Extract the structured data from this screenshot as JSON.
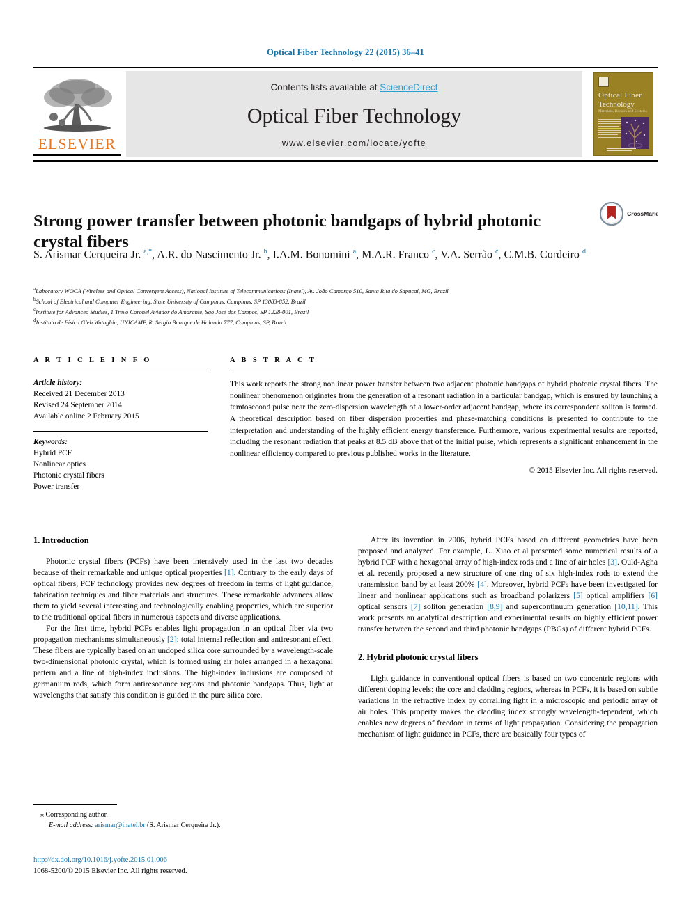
{
  "running_head": "Optical Fiber Technology 22 (2015) 36–41",
  "masthead": {
    "contents_prefix": "Contents lists available at ",
    "sciencedirect": "ScienceDirect",
    "journal_title": "Optical Fiber Technology",
    "journal_url": "www.elsevier.com/locate/yofte",
    "publisher_logo_text": "ELSEVIER",
    "cover": {
      "line1": "Optical  Fiber",
      "line2": "Technology",
      "line3": "Materials, Devices and Systems"
    }
  },
  "article": {
    "title": "Strong power transfer between photonic bandgaps of hybrid photonic crystal fibers",
    "crossmark_label": "CrossMark",
    "authors_html": "S. Arismar Cerqueira Jr. <sup>a,*</sup>, A.R. do Nascimento Jr. <sup>b</sup>, I.A.M. Bonomini <sup>a</sup>, M.A.R. Franco <sup>c</sup>, V.A. Serrão <sup>c</sup>, C.M.B. Cordeiro <sup>d</sup>",
    "affiliations": [
      {
        "marker": "a",
        "text": "Laboratory WOCA (Wireless and Optical Convergent Access), National Institute of Telecommunications (Inatel), Av. João Camargo 510, Santa Rita do Sapucaí, MG, Brazil"
      },
      {
        "marker": "b",
        "text": "School of Electrical and Computer Engineering, State University of Campinas, Campinas, SP 13083-852, Brazil"
      },
      {
        "marker": "c",
        "text": "Institute for Advanced Studies, 1 Trevo Coronel Aviador do Amarante, São José dos Campos, SP 1228-001, Brazil"
      },
      {
        "marker": "d",
        "text": "Instituto de Física Gleb Wataghin, UNICAMP, R. Sergio Buarque de Holanda 777, Campinas, SP, Brazil"
      }
    ]
  },
  "article_info": {
    "heading": "A R T I C L E   I N F O",
    "history_label": "Article history:",
    "history": [
      "Received 21 December 2013",
      "Revised 24 September 2014",
      "Available online 2 February 2015"
    ],
    "keywords_label": "Keywords:",
    "keywords": [
      "Hybrid PCF",
      "Nonlinear optics",
      "Photonic crystal fibers",
      "Power transfer"
    ]
  },
  "abstract": {
    "heading": "A B S T R A C T",
    "text": "This work reports the strong nonlinear power transfer between two adjacent photonic bandgaps of hybrid photonic crystal fibers. The nonlinear phenomenon originates from the generation of a resonant radiation in a particular bandgap, which is ensured by launching a femtosecond pulse near the zero-dispersion wavelength of a lower-order adjacent bandgap, where its correspondent soliton is formed. A theoretical description based on fiber dispersion properties and phase-matching conditions is presented to contribute to the interpretation and understanding of the highly efficient energy transference. Furthermore, various experimental results are reported, including the resonant radiation that peaks at 8.5 dB above that of the initial pulse, which represents a significant enhancement in the nonlinear efficiency compared to previous published works in the literature.",
    "copyright": "© 2015 Elsevier Inc. All rights reserved."
  },
  "body": {
    "left": {
      "section1_heading": "1. Introduction",
      "para1_html": "Photonic crystal fibers (PCFs) have been intensively used in the last two decades because of their remarkable and unique optical properties <span class=\"ref\">[1]</span>. Contrary to the early days of optical fibers, PCF technology provides new degrees of freedom in terms of light guidance, fabrication techniques and fiber materials and structures. These remarkable advances allow them to yield several interesting and technologically enabling properties, which are superior to the traditional optical fibers in numerous aspects and diverse applications.",
      "para2_html": "For the first time, hybrid PCFs enables light propagation in an optical fiber via two propagation mechanisms simultaneously <span class=\"ref\">[2]</span>: total internal reflection and antiresonant effect. These fibers are typically based on an undoped silica core surrounded by a wavelength-scale two-dimensional photonic crystal, which is formed using air holes arranged in a hexagonal pattern and a line of high-index inclusions. The high-index inclusions are composed of germanium rods, which form antiresonance regions and photonic bandgaps. Thus, light at wavelengths that satisfy this condition is guided in the pure silica core."
    },
    "right": {
      "para1_html": "After its invention in 2006, hybrid PCFs based on different geometries have been proposed and analyzed. For example, L. Xiao et al presented some numerical results of a hybrid PCF with a hexagonal array of high-index rods and a line of air holes <span class=\"ref\">[3]</span>. Ould-Agha et al. recently proposed a new structure of one ring of six high-index rods to extend the transmission band by at least 200% <span class=\"ref\">[4]</span>. Moreover, hybrid PCFs have been investigated for linear and nonlinear applications such as broadband polarizers <span class=\"ref\">[5]</span> optical amplifiers <span class=\"ref\">[6]</span> optical sensors <span class=\"ref\">[7]</span> soliton generation <span class=\"ref\">[8,9]</span> and supercontinuum generation <span class=\"ref\">[10,11]</span>. This work presents an analytical description and experimental results on highly efficient power transfer between the second and third photonic bandgaps (PBGs) of different hybrid PCFs.",
      "section2_heading": "2. Hybrid photonic crystal fibers",
      "para2_html": "Light guidance in conventional optical fibers is based on two concentric regions with different doping levels: the core and cladding regions, whereas in PCFs, it is based on subtle variations in the refractive index by corralling light in a microscopic and periodic array of air holes. This property makes the cladding index strongly wavelength-dependent, which enables new degrees of freedom in terms of light propagation. Considering the propagation mechanism of light guidance in PCFs, there are basically four types of"
    }
  },
  "footnote": {
    "corresponding_marker": "⁎",
    "corresponding_text": "Corresponding author.",
    "email_label": "E-mail address:",
    "email": "arismar@inatel.br",
    "email_owner": "(S. Arismar Cerqueira Jr.)."
  },
  "page_footer": {
    "doi": "http://dx.doi.org/10.1016/j.yofte.2015.01.006",
    "issn_line": "1068-5200/© 2015 Elsevier Inc. All rights reserved."
  },
  "colors": {
    "link": "#1672a8",
    "sciencedirect": "#2a9fd6",
    "elsevier_orange": "#e87722",
    "masthead_grey": "#e6e6e6",
    "cover_olive": "#9a8124",
    "cover_purple": "#4b2c63"
  }
}
